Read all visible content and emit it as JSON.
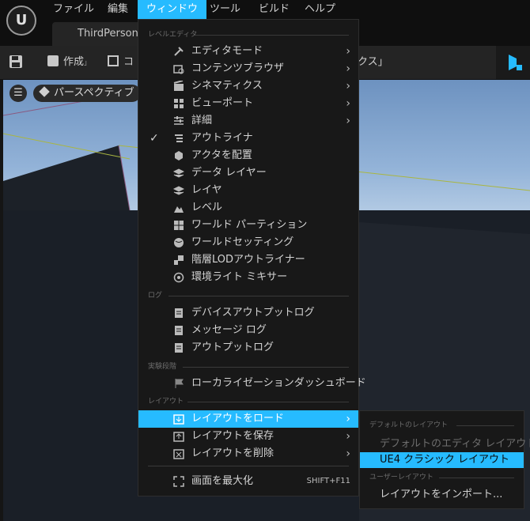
{
  "app": {
    "logo_text": "U",
    "document_tab": "ThirdPersonE"
  },
  "menubar": [
    "ファイル",
    "編集",
    "ウィンドウ",
    "ツール",
    "ビルド",
    "ヘルプ"
  ],
  "toolbar": {
    "create": "作成",
    "content": "コ",
    "cinematics_tail": "クス」"
  },
  "viewport": {
    "perspective": "パースペクティブ",
    "menu_glyph": "☰"
  },
  "window_menu": {
    "sections": {
      "level_editor": "レベルエディタ",
      "log": "ログ",
      "experimental": "実験段階",
      "layout": "レイアウト"
    },
    "level_editor_items": [
      {
        "label": "エディタモード",
        "icon": "mode-icon",
        "submenu": true
      },
      {
        "label": "コンテンツブラウザ",
        "icon": "content-browser-icon",
        "submenu": true
      },
      {
        "label": "シネマティクス",
        "icon": "cinematics-icon",
        "submenu": true
      },
      {
        "label": "ビューポート",
        "icon": "viewport-icon",
        "submenu": true
      },
      {
        "label": "詳細",
        "icon": "details-icon",
        "submenu": true
      },
      {
        "label": "アウトライナ",
        "icon": "outliner-icon",
        "checked": true
      },
      {
        "label": "アクタを配置",
        "icon": "place-actors-icon"
      },
      {
        "label": "データ レイヤー",
        "icon": "data-layers-icon"
      },
      {
        "label": "レイヤ",
        "icon": "layers-icon"
      },
      {
        "label": "レベル",
        "icon": "levels-icon"
      },
      {
        "label": "ワールド パーティション",
        "icon": "world-partition-icon"
      },
      {
        "label": "ワールドセッティング",
        "icon": "world-settings-icon"
      },
      {
        "label": "階層LODアウトライナー",
        "icon": "hlod-icon"
      },
      {
        "label": "環境ライト ミキサー",
        "icon": "env-light-icon"
      }
    ],
    "log_items": [
      {
        "label": "デバイスアウトプットログ",
        "icon": "device-log-icon"
      },
      {
        "label": "メッセージ ログ",
        "icon": "message-log-icon"
      },
      {
        "label": "アウトプットログ",
        "icon": "output-log-icon"
      }
    ],
    "experimental_items": [
      {
        "label": "ローカライゼーションダッシュボード",
        "icon": "localization-icon"
      }
    ],
    "layout_items": [
      {
        "label": "レイアウトをロード",
        "icon": "load-layout-icon",
        "submenu": true,
        "highlighted": true
      },
      {
        "label": "レイアウトを保存",
        "icon": "save-layout-icon",
        "submenu": true
      },
      {
        "label": "レイアウトを削除",
        "icon": "delete-layout-icon",
        "submenu": true
      }
    ],
    "fullscreen": {
      "label": "画面を最大化",
      "shortcut": "SHIFT+F11",
      "icon": "maximize-icon"
    }
  },
  "load_layout_submenu": {
    "default_header": "デフォルトのレイアウト",
    "default_item": "デフォルトのエディタ レイアウト",
    "ue4_item": "UE4 クラシック レイアウト",
    "user_header": "ユーザーレイアウト",
    "import_item": "レイアウトをインポート..."
  },
  "colors": {
    "accent": "#26bbff",
    "menu_bg": "#181818"
  }
}
